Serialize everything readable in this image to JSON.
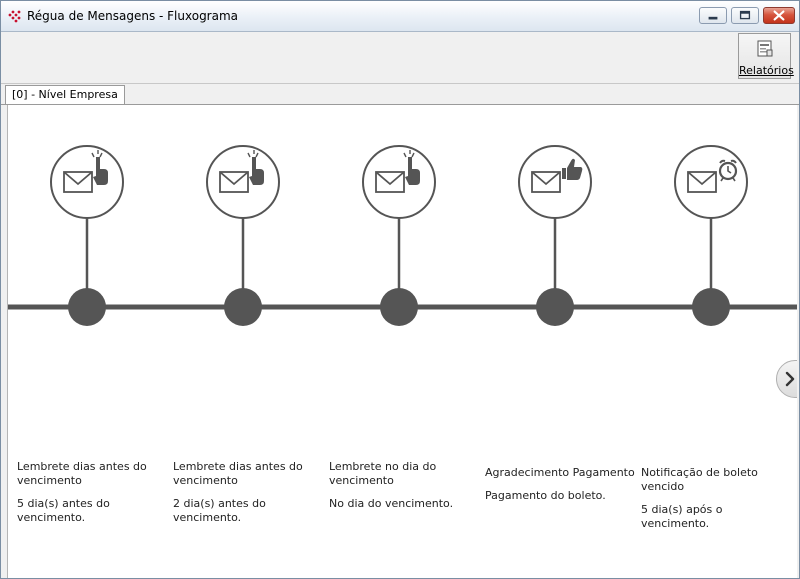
{
  "window": {
    "title": "Régua de Mensagens - Fluxograma"
  },
  "toolbar": {
    "reports_label": "Relatórios"
  },
  "tabs": [
    {
      "label": "[0]  - Nível Empresa"
    }
  ],
  "timeline": {
    "line_color": "#555555",
    "steps": [
      {
        "icon": "envelope-touch-icon",
        "title": "Lembrete dias antes do vencimento",
        "description": "5 dia(s) antes do vencimento."
      },
      {
        "icon": "envelope-touch-icon",
        "title": "Lembrete dias antes do vencimento",
        "description": "2 dia(s) antes do vencimento."
      },
      {
        "icon": "envelope-touch-icon",
        "title": "Lembrete no dia do vencimento",
        "description": "No dia do vencimento."
      },
      {
        "icon": "envelope-thumbs-up-icon",
        "title": "Agradecimento Pagamento",
        "description": "Pagamento do boleto."
      },
      {
        "icon": "envelope-alarm-clock-icon",
        "title": "Notificação de boleto vencido",
        "description": "5 dia(s) após o vencimento."
      }
    ]
  }
}
